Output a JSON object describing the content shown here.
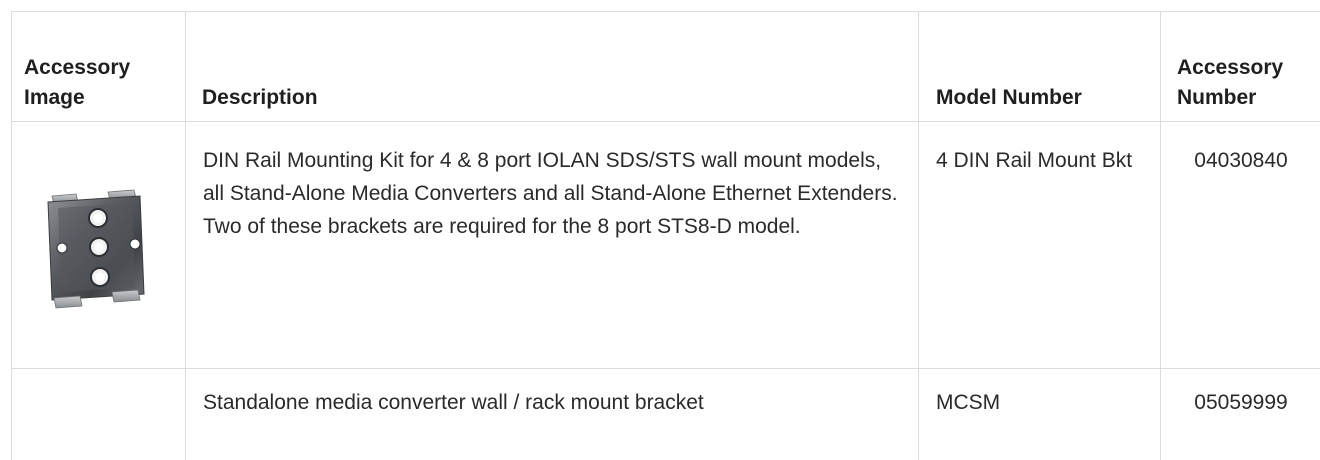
{
  "table": {
    "headers": {
      "image": "Accessory Image",
      "description": "Description",
      "model": "Model Number",
      "accessory_number": "Accessory Number"
    },
    "rows": [
      {
        "image": "din-rail-bracket-image",
        "description": "DIN Rail Mounting Kit for 4 & 8 port IOLAN SDS/STS wall mount models, all Stand-Alone Media Converters and all Stand-Alone Ethernet Extenders. Two of these brackets are required for the 8 port STS8-D model.",
        "model": "4 DIN Rail Mount Bkt",
        "accessory_number": "04030840"
      },
      {
        "image": "",
        "description": "Standalone media converter wall / rack mount bracket",
        "model": "MCSM",
        "accessory_number": "05059999"
      }
    ]
  }
}
